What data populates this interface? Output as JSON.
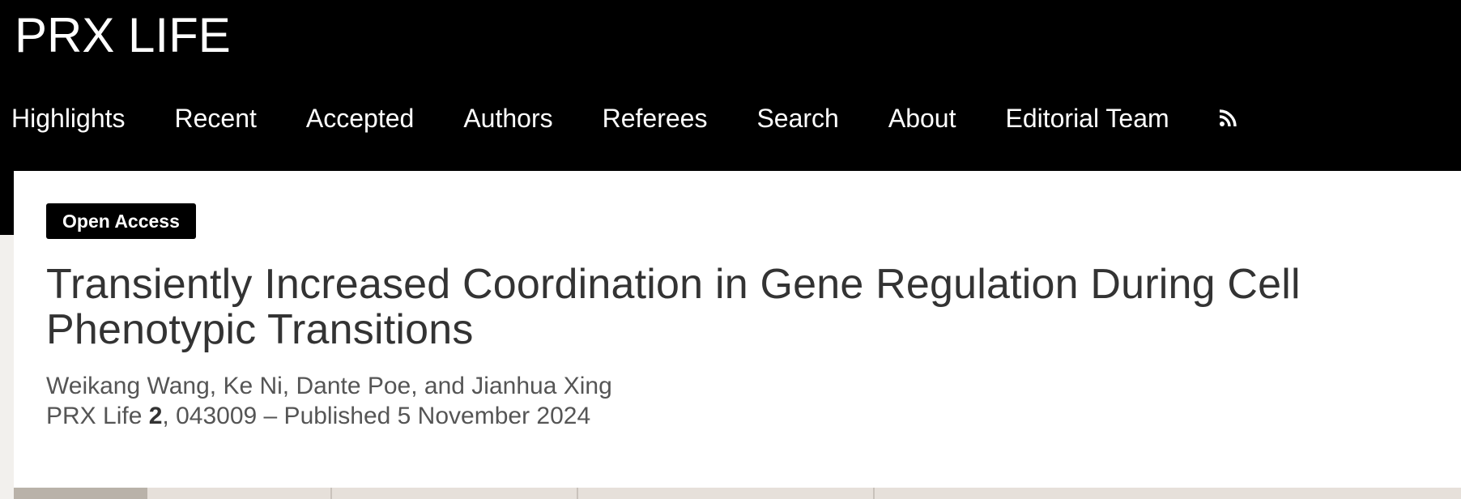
{
  "header": {
    "logo": "PRX LIFE",
    "nav": [
      {
        "label": "Highlights"
      },
      {
        "label": "Recent"
      },
      {
        "label": "Accepted"
      },
      {
        "label": "Authors"
      },
      {
        "label": "Referees"
      },
      {
        "label": "Search"
      },
      {
        "label": "About"
      },
      {
        "label": "Editorial Team"
      }
    ],
    "rss_icon": "rss-feed-icon"
  },
  "article": {
    "badge": "Open Access",
    "title": "Transiently Increased Coordination in Gene Regulation During Cell Phenotypic Transitions",
    "authors": "Weikang Wang, Ke Ni, Dante Poe, and Jianhua Xing",
    "journal": "PRX Life",
    "volume": "2",
    "citation_rest": ", 043009 – Published 5 November 2024"
  },
  "colors": {
    "header_bg": "#000000",
    "page_bg": "#f2f0ed",
    "tab_bar": "#e6e0da",
    "active_tab": "#b9b2a9"
  }
}
